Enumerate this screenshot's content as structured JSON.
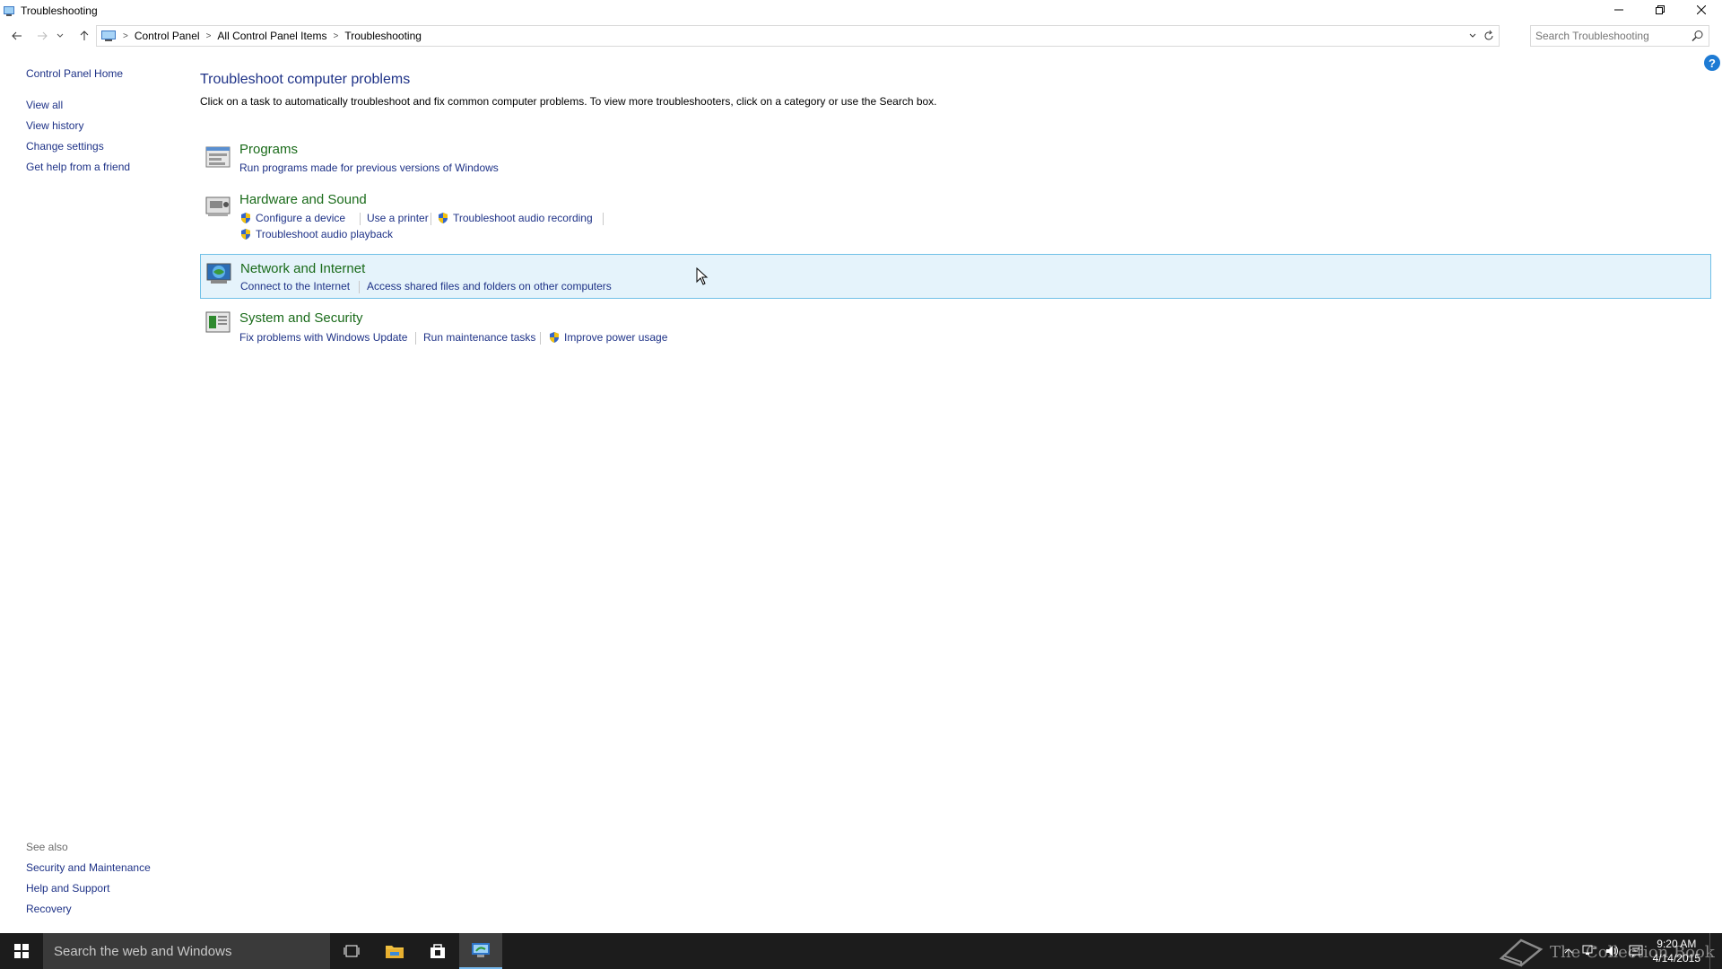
{
  "window": {
    "title": "Troubleshooting"
  },
  "breadcrumb": [
    "Control Panel",
    "All Control Panel Items",
    "Troubleshooting"
  ],
  "search": {
    "placeholder": "Search Troubleshooting"
  },
  "leftpane": {
    "home": "Control Panel Home",
    "links": [
      "View all",
      "View history",
      "Change settings",
      "Get help from a friend"
    ],
    "see_also_label": "See also",
    "see_also": [
      "Security and Maintenance",
      "Help and Support",
      "Recovery"
    ]
  },
  "main": {
    "heading": "Troubleshoot computer problems",
    "description": "Click on a task to automatically troubleshoot and fix common computer problems. To view more troubleshooters, click on a category or use the Search box.",
    "categories": [
      {
        "title": "Programs",
        "tasks": [
          "Run programs made for previous versions of Windows"
        ]
      },
      {
        "title": "Hardware and Sound",
        "tasks": [
          "Configure a device",
          "Use a printer",
          "Troubleshoot audio recording",
          "Troubleshoot audio playback"
        ]
      },
      {
        "title": "Network and Internet",
        "tasks": [
          "Connect to the Internet",
          "Access shared files and folders on other computers"
        ]
      },
      {
        "title": "System and Security",
        "tasks": [
          "Fix problems with Windows Update",
          "Run maintenance tasks",
          "Improve power usage"
        ]
      }
    ]
  },
  "taskbar": {
    "search_placeholder": "Search the web and Windows",
    "watermark": "The Collection Book",
    "time": "9:20 AM",
    "date": "4/14/2015"
  },
  "colors": {
    "link": "#1e3287",
    "category": "#1a6b1a",
    "hover_bg": "#e5f3fb",
    "hover_border": "#70c0e7",
    "taskbar": "#1c1c1c"
  }
}
